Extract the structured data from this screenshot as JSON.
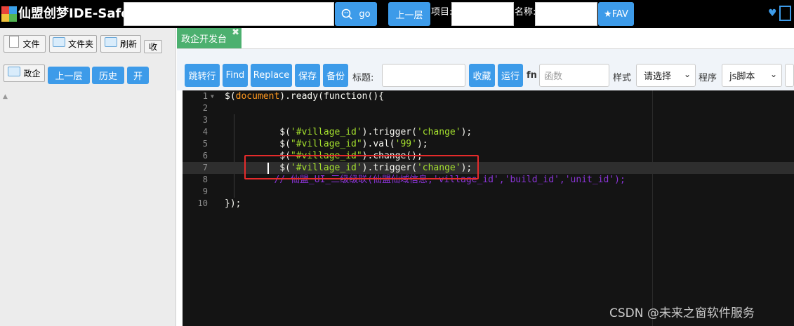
{
  "app": {
    "title": "仙盟创梦IDE-Safe",
    "go_label": "go",
    "up_label": "上一层",
    "project_label": "项目:",
    "name_label": "名称:",
    "fav_label": "★FAV"
  },
  "left": {
    "file_label": "文件",
    "folder_label": "文件夹",
    "refresh_label": "刷新",
    "collapse_label": "收",
    "zhengqi_label": "政企",
    "up_label": "上一层",
    "history_label": "历史",
    "open_label": "开"
  },
  "tabs": [
    {
      "label": "政企开发台",
      "close": "✖"
    }
  ],
  "toolbar": {
    "goto_label": "跳转行",
    "find_label": "Find",
    "replace_label": "Replace",
    "save_label": "保存",
    "backup_label": "备份",
    "title_label": "标题:",
    "fav_label": "收藏",
    "run_label": "运行",
    "fn_label": "fn",
    "func_placeholder": "函数",
    "style_label": "样式",
    "style_value": "请选择",
    "program_label": "程序",
    "program_value": "js脚本"
  },
  "editor": {
    "lines": [
      {
        "n": "1",
        "fold": "▼",
        "parts": [
          [
            "t-dollar",
            "$("
          ],
          [
            "t-kw",
            "document"
          ],
          [
            "t-fn",
            ").ready(function(){"
          ]
        ]
      },
      {
        "n": "2",
        "parts": []
      },
      {
        "n": "3",
        "parts": []
      },
      {
        "n": "4",
        "parts": [
          [
            "t-fn",
            "          $("
          ],
          [
            "t-str",
            "'#village_id'"
          ],
          [
            "t-fn",
            ").trigger("
          ],
          [
            "t-str",
            "'change'"
          ],
          [
            "t-fn",
            ");"
          ]
        ]
      },
      {
        "n": "5",
        "parts": [
          [
            "t-fn",
            "          $("
          ],
          [
            "t-str",
            "\"#village_id\""
          ],
          [
            "t-fn",
            ").val("
          ],
          [
            "t-str",
            "'99'"
          ],
          [
            "t-fn",
            ");"
          ]
        ]
      },
      {
        "n": "6",
        "parts": [
          [
            "t-fn",
            "          $("
          ],
          [
            "t-str",
            "\"#village_id\""
          ],
          [
            "t-fn",
            ").change();"
          ]
        ]
      },
      {
        "n": "7",
        "parts": [
          [
            "t-fn",
            "          $("
          ],
          [
            "t-str",
            "'#village_id'"
          ],
          [
            "t-fn",
            ").trigger("
          ],
          [
            "t-str",
            "'change'"
          ],
          [
            "t-fn",
            ");"
          ]
        ]
      },
      {
        "n": "8",
        "parts": [
          [
            "t-cm",
            "         // 仙盟_UI_三级级联(仙盟仙域信息,'village_id','build_id','unit_id');"
          ]
        ]
      },
      {
        "n": "9",
        "parts": []
      },
      {
        "n": "10",
        "parts": [
          [
            "t-fn",
            "});"
          ]
        ]
      }
    ]
  },
  "watermark": "CSDN @未来之窗软件服务",
  "colors": {
    "accent_blue": "#3d9be9",
    "tab_green": "#4cb06f",
    "highlight_red": "#e52b2b"
  },
  "icons": [
    "heart-icon",
    "window-icon",
    "file-icon",
    "folder-icon",
    "search-icon"
  ]
}
